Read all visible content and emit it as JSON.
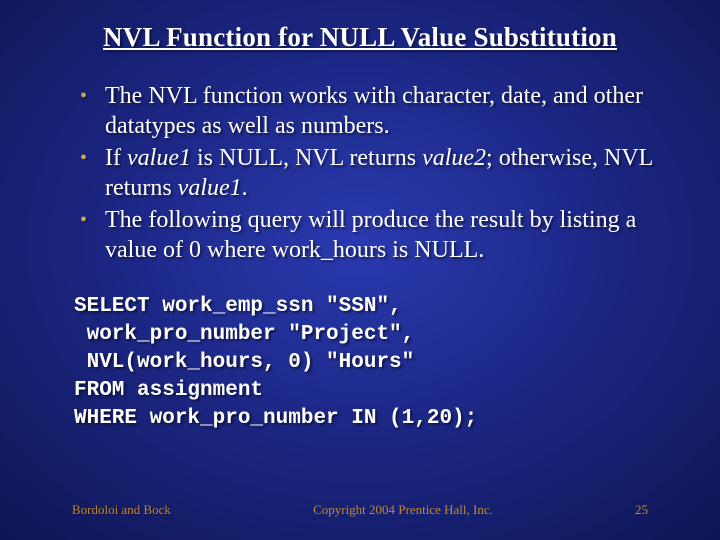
{
  "title": "NVL Function for NULL Value Substitution",
  "bullets": {
    "b1a": "The NVL function works with character, date, and other datatypes as well as numbers.",
    "b2_pre": "If ",
    "b2_v1": "value1",
    "b2_mid": " is NULL, NVL returns ",
    "b2_v2": "value2",
    "b2_mid2": "; otherwise, NVL returns ",
    "b2_v1b": "value1",
    "b2_end": ".",
    "b3": "The following query will produce the result by listing a value of 0 where work_hours is NULL."
  },
  "code": "SELECT work_emp_ssn \"SSN\",\n work_pro_number \"Project\",\n NVL(work_hours, 0) \"Hours\"\nFROM assignment\nWHERE work_pro_number IN (1,20);",
  "footer": {
    "left": "Bordoloi and Bock",
    "center": "Copyright 2004 Prentice Hall, Inc.",
    "right": "25"
  }
}
